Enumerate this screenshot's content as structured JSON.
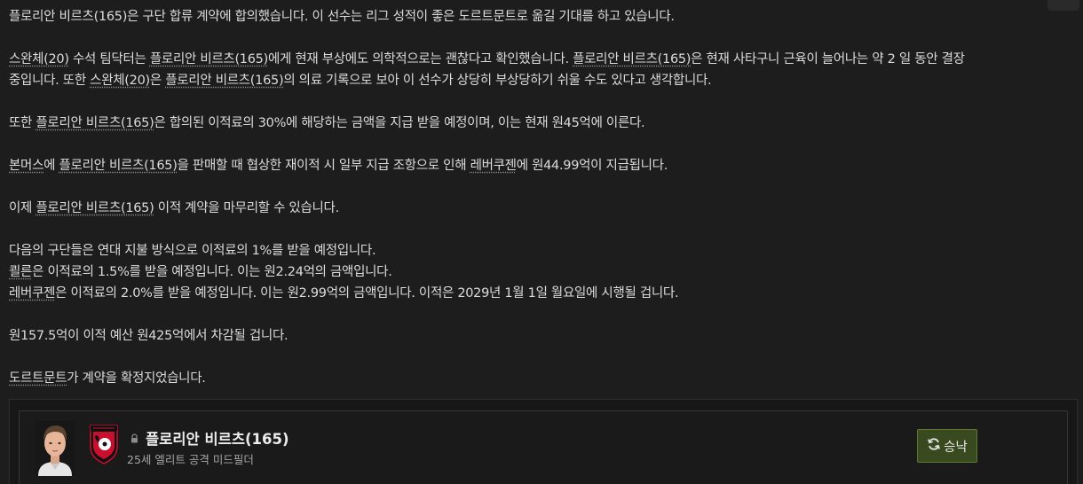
{
  "message": {
    "p1": "플로리안 비르츠(165)은 구단 합류 계약에 합의했습니다. 이 선수는 리그 성적이 좋은 도르트문트로 옮길 기대를 하고 있습니다.",
    "p2_a1": "스완체(20)",
    "p2_a2": " 수석 팀닥터는 ",
    "p2_a3": "플로리안 비르츠(165)",
    "p2_a4": "에게 현재 부상에도 의학적으로는 괜찮다고 확인했습니다. ",
    "p2_a5": "플로리안 비르츠(165)",
    "p2_a6": "은 현재 사타구니 근육이 늘어나는 약 2 일 동안 결장",
    "p2_b1": "중입니다. 또한 ",
    "p2_b2": "스완체(20)",
    "p2_b3": "은 ",
    "p2_b4": "플로리안 비르츠(165)",
    "p2_b5": "의 의료 기록으로 보아 이 선수가 상당히 부상당하기 쉬울 수도 있다고 생각합니다.",
    "p3_1": "또한 ",
    "p3_2": "플로리안 비르츠(165)",
    "p3_3": "은 합의된 이적료의 30%에 해당하는 금액을 지급 받을 예정이며, 이는 현재 원45억에 이른다.",
    "p4_1": "본머스",
    "p4_2": "에 ",
    "p4_3": "플로리안 비르츠(165)",
    "p4_4": "을 판매할 때 협상한 재이적 시 일부 지급 조항으로 인해 ",
    "p4_5": "레버쿠젠",
    "p4_6": "에 원44.99억이 지급됩니다.",
    "p5_1": "이제 ",
    "p5_2": "플로리안 비르츠(165)",
    "p5_3": " 이적 계약을 마무리할 수 있습니다.",
    "p6_l1": "다음의 구단들은 연대 지불 방식으로 이적료의 1%를 받을 예정입니다.",
    "p6_l2_a": "쾰른",
    "p6_l2_b": "은 이적료의 1.5%를 받을 예정입니다. 이는 원2.24억의 금액입니다.",
    "p6_l3_a": "레버쿠젠",
    "p6_l3_b": "은 이적료의 2.0%를 받을 예정입니다. 이는 원2.99억의 금액입니다. 이적은 2029년 1월 1일 월요일에 시행될 겁니다.",
    "p7": "원157.5억이 이적 예산 원425억에서 차감될 겁니다.",
    "p8_1": "도르트문트",
    "p8_2": "가 계약을 확정지었습니다."
  },
  "player_card": {
    "name": "플로리안 비르츠(165)",
    "subtitle": "25세 엘리트 공격 미드필더",
    "accept_label": "승낙",
    "portrait_icon": "player-portrait",
    "crest_icon": "club-crest",
    "lock_icon": "lock-icon",
    "refresh_icon": "refresh-icon"
  },
  "colors": {
    "background": "#1d1d1d",
    "text": "#dcdcdc",
    "accept_button": "#3a4a20",
    "accept_border": "#5e7a2e",
    "crest_red": "#c8102e"
  }
}
